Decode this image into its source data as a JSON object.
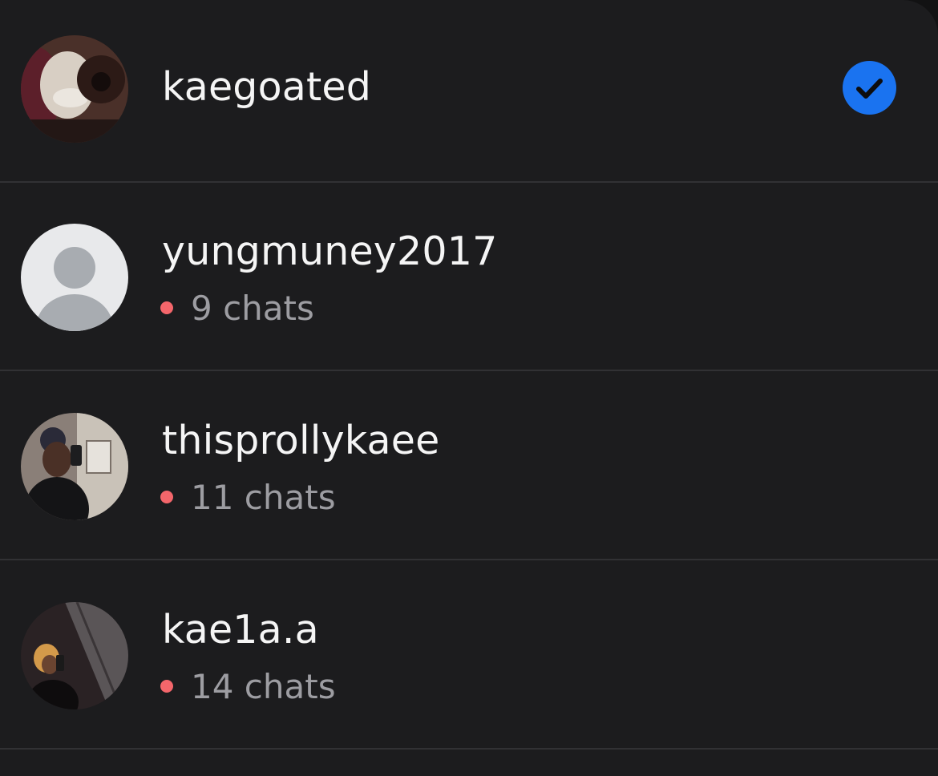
{
  "theme": {
    "accent": "#1a73f0",
    "unread_dot": "#f4666b"
  },
  "accounts": [
    {
      "username": "kaegoated",
      "avatar": "profile-photo",
      "selected": true,
      "selected_icon": "checkmark-circle-icon"
    },
    {
      "username": "yungmuney2017",
      "avatar": "default-avatar-icon",
      "unread_label": "9 chats"
    },
    {
      "username": "thisprollykaee",
      "avatar": "profile-photo",
      "unread_label": "11 chats"
    },
    {
      "username": "kae1a.a",
      "avatar": "profile-photo",
      "unread_label": "14 chats"
    }
  ]
}
